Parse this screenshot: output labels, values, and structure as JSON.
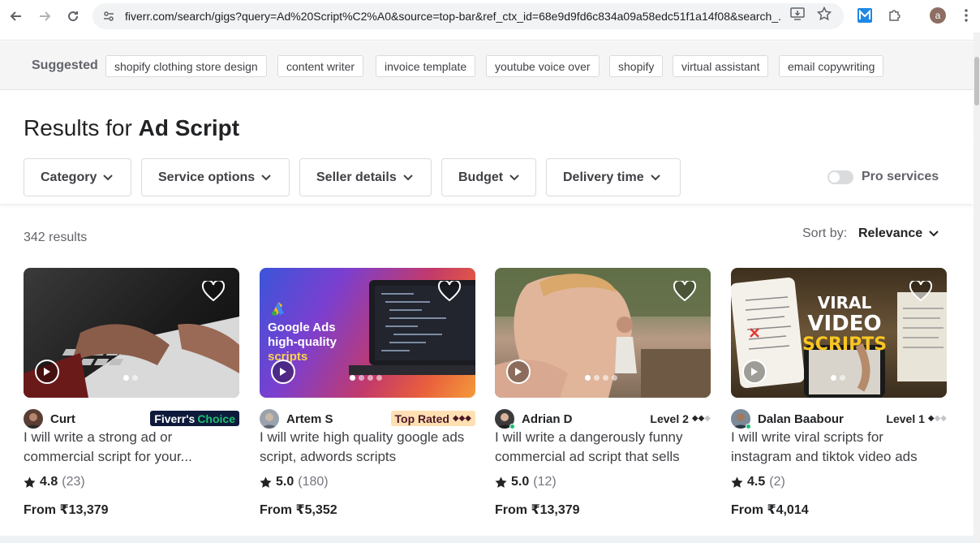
{
  "browser": {
    "url": "fiverr.com/search/gigs?query=Ad%20Script%C2%A0&source=top-bar&ref_ctx_id=68e9d9fd6c834a09a58edc51f1a14f08&search_...",
    "profile_initial": "a"
  },
  "suggested": {
    "label": "Suggested",
    "chips": [
      "shopify clothing store design",
      "content writer",
      "invoice template",
      "youtube voice over",
      "shopify",
      "virtual assistant",
      "email copywriting"
    ]
  },
  "results": {
    "prefix": "Results for",
    "query": "Ad Script",
    "count": "342 results"
  },
  "filters": {
    "items": [
      "Category",
      "Service options",
      "Seller details",
      "Budget",
      "Delivery time"
    ],
    "pro_label": "Pro services",
    "pro_enabled": false
  },
  "sort": {
    "label": "Sort by:",
    "value": "Relevance"
  },
  "cards": [
    {
      "seller": "Curt",
      "badge_main": "Fiverr's",
      "badge_accent": "Choice",
      "title": "I will write a strong ad or commercial script for your...",
      "score": "4.8",
      "reviews": "(23)",
      "price": "From ₹13,379",
      "slides": 2,
      "slide_active": 0
    },
    {
      "seller": "Artem S",
      "badge_main": "Top Rated",
      "badge_diamonds": "◆◆◆",
      "thumb_text_1": "Google Ads",
      "thumb_text_2": "high-quality",
      "thumb_text_3": "scripts",
      "title": "I will write high quality google ads script, adwords scripts",
      "score": "5.0",
      "reviews": "(180)",
      "price": "From ₹5,352",
      "slides": 4,
      "slide_active": 0
    },
    {
      "seller": "Adrian D",
      "badge_main": "Level 2",
      "badge_diamonds": "◆◆",
      "badge_diamonds_dim": "◆",
      "title": "I will write a dangerously funny commercial ad script that sells",
      "score": "5.0",
      "reviews": "(12)",
      "price": "From ₹13,379",
      "slides": 4,
      "slide_active": 0
    },
    {
      "seller": "Dalan Baabour",
      "badge_main": "Level 1",
      "badge_diamonds": "◆",
      "badge_diamonds_dim": "◆◆",
      "thumb_text_1": "VIRAL",
      "thumb_text_2": "VIDEO",
      "thumb_text_3": "SCRIPTS",
      "title": "I will write viral scripts for instagram and tiktok video ads",
      "score": "4.5",
      "reviews": "(2)",
      "price": "From ₹4,014",
      "slides": 2,
      "slide_active": 0
    }
  ],
  "colors": {
    "accent_green": "#1dbf73",
    "fiverr_choice_bg": "#0e1a3b",
    "top_rated_bg": "#ffe0b3"
  }
}
